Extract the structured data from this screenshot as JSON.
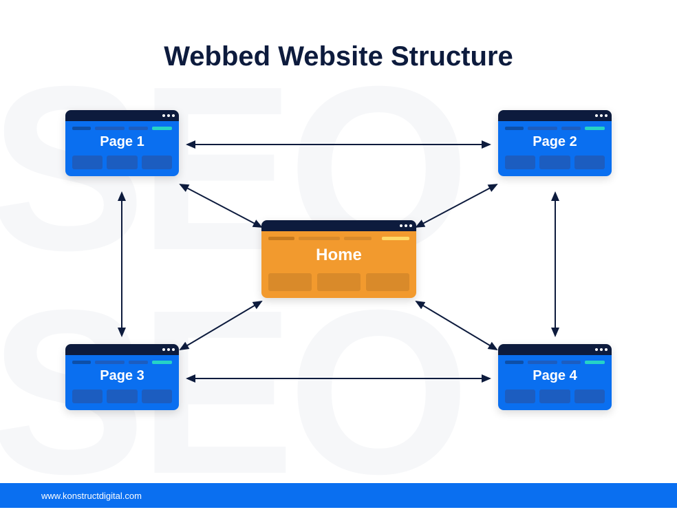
{
  "title": "Webbed Website Structure",
  "bg_text": "SEO",
  "nodes": {
    "p1": {
      "label": "Page 1"
    },
    "p2": {
      "label": "Page 2"
    },
    "p3": {
      "label": "Page 3"
    },
    "p4": {
      "label": "Page 4"
    },
    "home": {
      "label": "Home"
    }
  },
  "footer": {
    "url": "www.konstructdigital.com"
  },
  "colors": {
    "blue": "#0a6ff0",
    "orange": "#f29a2e",
    "dark": "#0d1b3d",
    "teal": "#26d3c6"
  }
}
